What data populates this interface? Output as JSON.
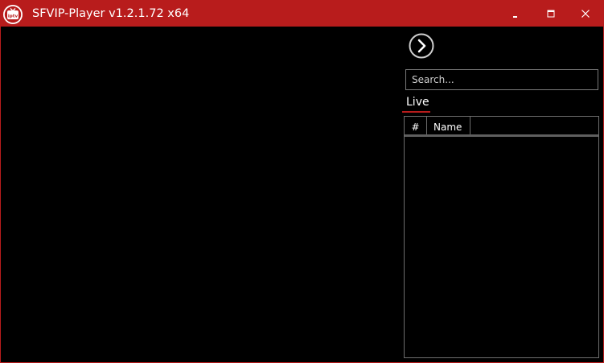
{
  "window": {
    "title": "SFVIP-Player v1.2.1.72 x64",
    "accent_color": "#b81c1c",
    "background_color": "#000000",
    "logo_icon": "iptv-tv-icon",
    "logo_text": "iptv"
  },
  "controls": {
    "minimize_icon": "minimize-icon",
    "maximize_icon": "maximize-icon",
    "close_icon": "close-icon"
  },
  "sidebar": {
    "next_icon": "chevron-right-circle-icon",
    "search": {
      "placeholder": "Search...",
      "value": ""
    },
    "tabs": [
      {
        "label": "Live",
        "active": true
      }
    ],
    "table": {
      "columns": [
        "#",
        "Name"
      ],
      "rows": []
    }
  }
}
